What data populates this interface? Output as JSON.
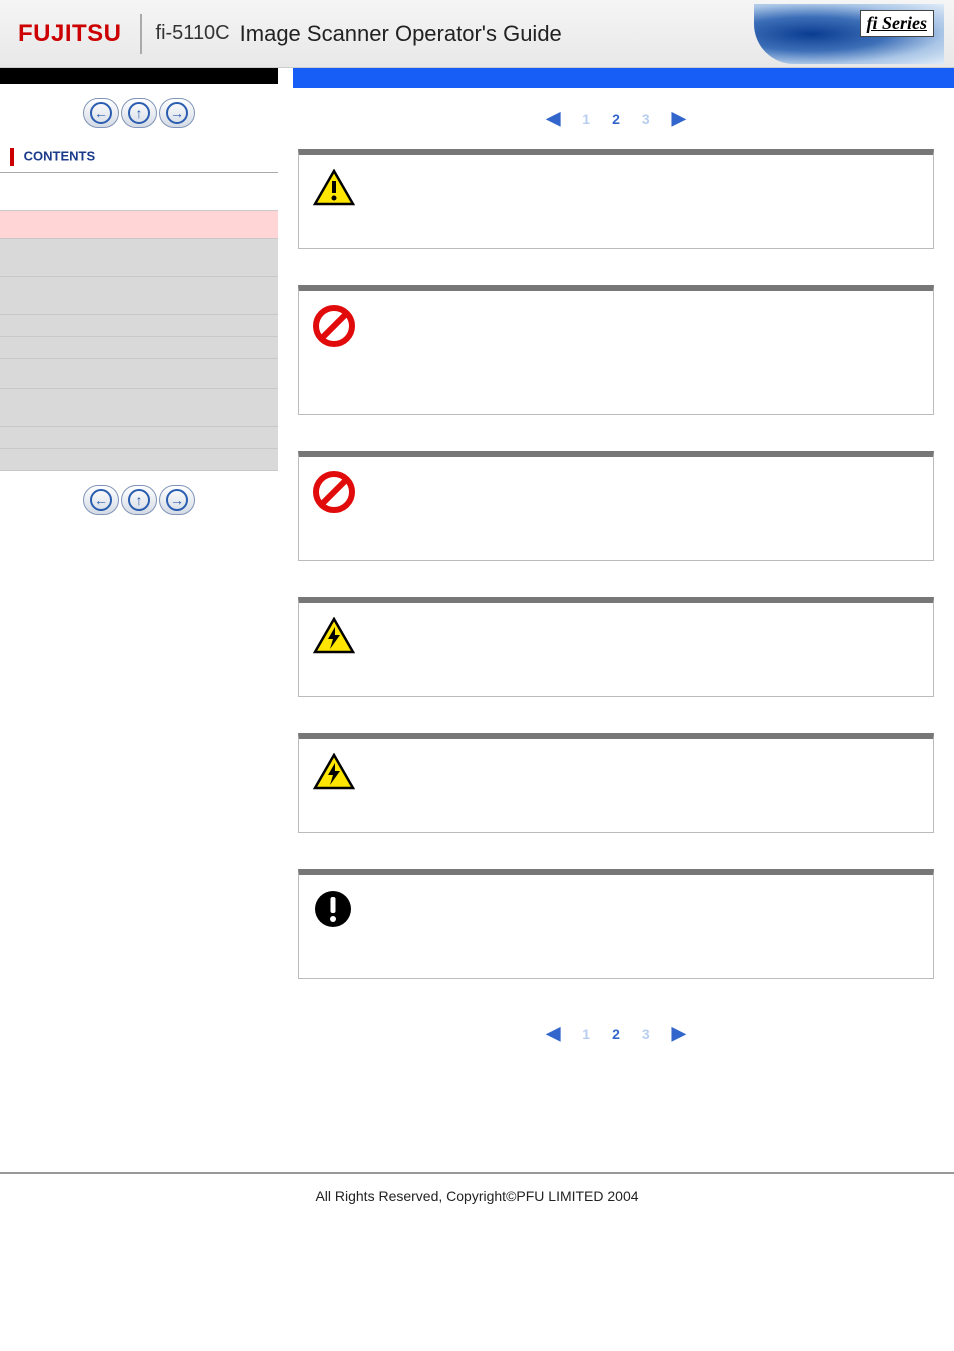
{
  "header": {
    "brand": "FUJITSU",
    "model": "fi-5110C",
    "title": "Image Scanner Operator's Guide",
    "series_label": "fi Series"
  },
  "nav": {
    "prev_title": "Previous",
    "up_title": "Up",
    "next_title": "Next"
  },
  "toc": {
    "contents_label": "CONTENTS",
    "items": [
      {
        "key": "intro",
        "label": ""
      },
      {
        "key": "safety",
        "label": ""
      },
      {
        "key": "chap1",
        "label": ""
      },
      {
        "key": "chap2",
        "label": ""
      },
      {
        "key": "chap3",
        "label": ""
      },
      {
        "key": "chap4",
        "label": ""
      },
      {
        "key": "chap5",
        "label": ""
      },
      {
        "key": "chap6",
        "label": ""
      },
      {
        "key": "chap7",
        "label": ""
      },
      {
        "key": "chap8",
        "label": ""
      }
    ]
  },
  "pager": {
    "pages": [
      "1",
      "2",
      "3"
    ],
    "current": 2
  },
  "safety_blocks": [
    {
      "icon": "warning-triangle",
      "text": ""
    },
    {
      "icon": "prohibition",
      "text": ""
    },
    {
      "icon": "prohibition",
      "text": ""
    },
    {
      "icon": "electric-warning",
      "text": ""
    },
    {
      "icon": "electric-warning",
      "text": ""
    },
    {
      "icon": "mandatory-info",
      "text": ""
    }
  ],
  "footer": {
    "copyright": "All Rights Reserved, Copyright©PFU LIMITED 2004"
  }
}
